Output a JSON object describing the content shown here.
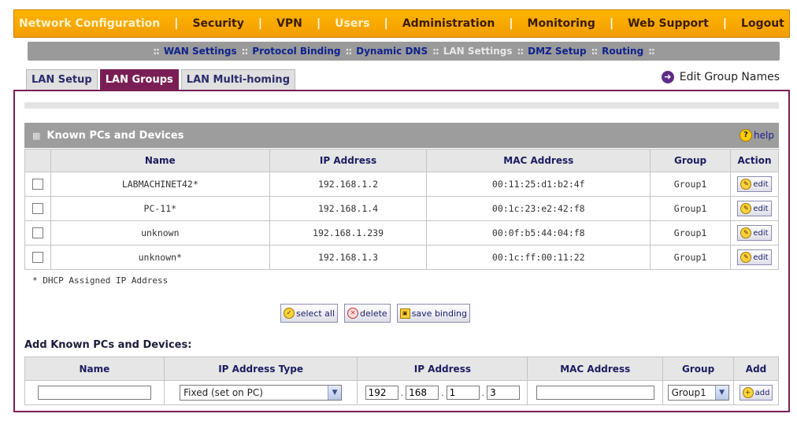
{
  "top_menu": {
    "items": [
      {
        "label": "Network Configuration",
        "dim": true
      },
      {
        "label": "Security",
        "dim": false
      },
      {
        "label": "VPN",
        "dim": false
      },
      {
        "label": "Users",
        "dim": true
      },
      {
        "label": "Administration",
        "dim": false
      },
      {
        "label": "Monitoring",
        "dim": false
      },
      {
        "label": "Web Support",
        "dim": false
      },
      {
        "label": "Logout",
        "dim": false
      }
    ],
    "separator": "|"
  },
  "sub_menu": {
    "items": [
      "WAN Settings",
      "Protocol Binding",
      "Dynamic DNS",
      "LAN Settings",
      "DMZ Setup",
      "Routing"
    ],
    "active": "LAN Settings",
    "separator": "::"
  },
  "tabs": [
    "LAN Setup",
    "LAN Groups",
    "LAN Multi-homing"
  ],
  "active_tab": "LAN Groups",
  "edit_group_names": "Edit Group Names",
  "known_section": {
    "title": "Known PCs and Devices",
    "help_label": "help",
    "columns": [
      "Name",
      "IP Address",
      "MAC Address",
      "Group",
      "Action"
    ],
    "rows": [
      {
        "name": "LABMACHINET42*",
        "ip": "192.168.1.2",
        "mac": "00:11:25:d1:b2:4f",
        "group": "Group1",
        "action": "edit"
      },
      {
        "name": "PC-11*",
        "ip": "192.168.1.4",
        "mac": "00:1c:23:e2:42:f8",
        "group": "Group1",
        "action": "edit"
      },
      {
        "name": "unknown",
        "ip": "192.168.1.239",
        "mac": "00:0f:b5:44:04:f8",
        "group": "Group1",
        "action": "edit"
      },
      {
        "name": "unknown*",
        "ip": "192.168.1.3",
        "mac": "00:1c:ff:00:11:22",
        "group": "Group1",
        "action": "edit"
      }
    ]
  },
  "footnote": "* DHCP Assigned IP Address",
  "buttons": {
    "select_all": "select all",
    "delete": "delete",
    "save_binding": "save binding"
  },
  "add_section": {
    "title": "Add Known PCs and Devices:",
    "columns": [
      "Name",
      "IP Address Type",
      "IP Address",
      "MAC Address",
      "Group",
      "Add"
    ],
    "name_value": "",
    "ip_type_value": "Fixed (set on PC)",
    "ip_octets": [
      "192",
      "168",
      "1",
      "3"
    ],
    "mac_value": "",
    "group_value": "Group1",
    "add_label": "add"
  },
  "icons": {
    "edit": "pencil-icon",
    "help": "question-icon",
    "select_all": "check-icon",
    "delete": "x-icon",
    "save": "save-icon",
    "add": "plus-icon",
    "edit_group": "arrow-right-icon"
  },
  "colors": {
    "top_menu": "#f29d00",
    "active_tab": "#7a1f55",
    "section_header": "#9d9d9d",
    "link_text": "#1c1c62"
  }
}
